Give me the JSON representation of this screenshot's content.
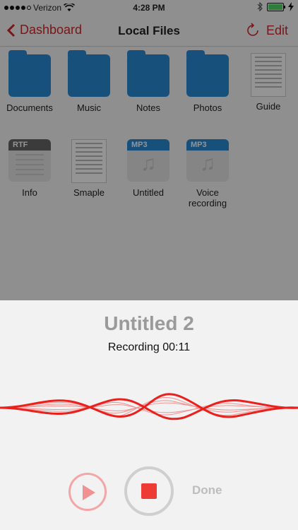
{
  "status_bar": {
    "carrier": "Verizon",
    "time": "4:28 PM",
    "signal_icon": "signal-dots-icon",
    "wifi_icon": "wifi-icon",
    "bluetooth_icon": "bluetooth-icon",
    "battery_icon": "battery-icon",
    "battery_level": 1.0,
    "charging_icon": "bolt-icon"
  },
  "nav": {
    "back_label": "Dashboard",
    "back_icon": "chevron-left-icon",
    "title": "Local Files",
    "refresh_icon": "refresh-icon",
    "edit_label": "Edit"
  },
  "files": [
    {
      "label": "Documents",
      "icon": "folder-icon"
    },
    {
      "label": "Music",
      "icon": "folder-icon"
    },
    {
      "label": "Notes",
      "icon": "folder-icon"
    },
    {
      "label": "Photos",
      "icon": "folder-icon"
    },
    {
      "label": "Guide",
      "icon": "document-icon"
    },
    {
      "label": "Info",
      "icon": "rtf-file-icon",
      "badge": "RTF"
    },
    {
      "label": "Smaple",
      "icon": "document-icon"
    },
    {
      "label": "Untitled",
      "icon": "mp3-file-icon",
      "badge": "MP3"
    },
    {
      "label": "Voice recording",
      "icon": "mp3-file-icon",
      "badge": "MP3"
    }
  ],
  "recorder": {
    "title": "Untitled 2",
    "status": "Recording 00:11",
    "play_icon": "play-icon",
    "stop_icon": "stop-icon",
    "done_label": "Done"
  },
  "colors": {
    "accent": "#d0262b",
    "folder": "#2a8ad6",
    "rtf_band": "#666666",
    "mp3_band": "#2a8ad6",
    "wave": "#e8211d"
  }
}
